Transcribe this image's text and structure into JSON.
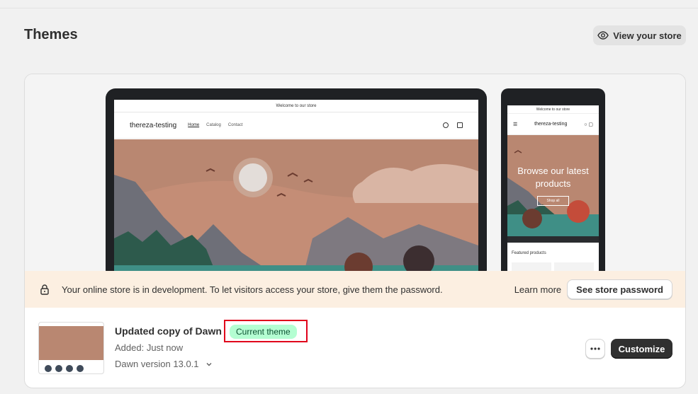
{
  "page": {
    "title": "Themes"
  },
  "header": {
    "view_store_label": "View your store",
    "view_store_icon": "eye-icon"
  },
  "preview": {
    "desktop": {
      "announcement": "Welcome to our store",
      "store_name": "thereza-testing",
      "nav": [
        "Home",
        "Catalog",
        "Contact"
      ]
    },
    "mobile": {
      "announcement": "Welcome to our store",
      "store_name": "thereza-testing",
      "hero_text": "Browse our latest products",
      "shop_all": "Shop all",
      "featured": "Featured products"
    }
  },
  "banner": {
    "message": "Your online store is in development. To let visitors access your store, give them the password.",
    "learn_more": "Learn more",
    "see_password": "See store password",
    "icon": "lock-icon"
  },
  "theme": {
    "name": "Updated copy of Dawn",
    "badge": "Current theme",
    "added": "Added: Just now",
    "version": "Dawn version 13.0.1",
    "customize": "Customize"
  },
  "colors": {
    "badge_bg": "#b4fed2",
    "banner_bg": "#fcefe1",
    "primary_button": "#303030",
    "highlight_box": "#e0001b"
  }
}
